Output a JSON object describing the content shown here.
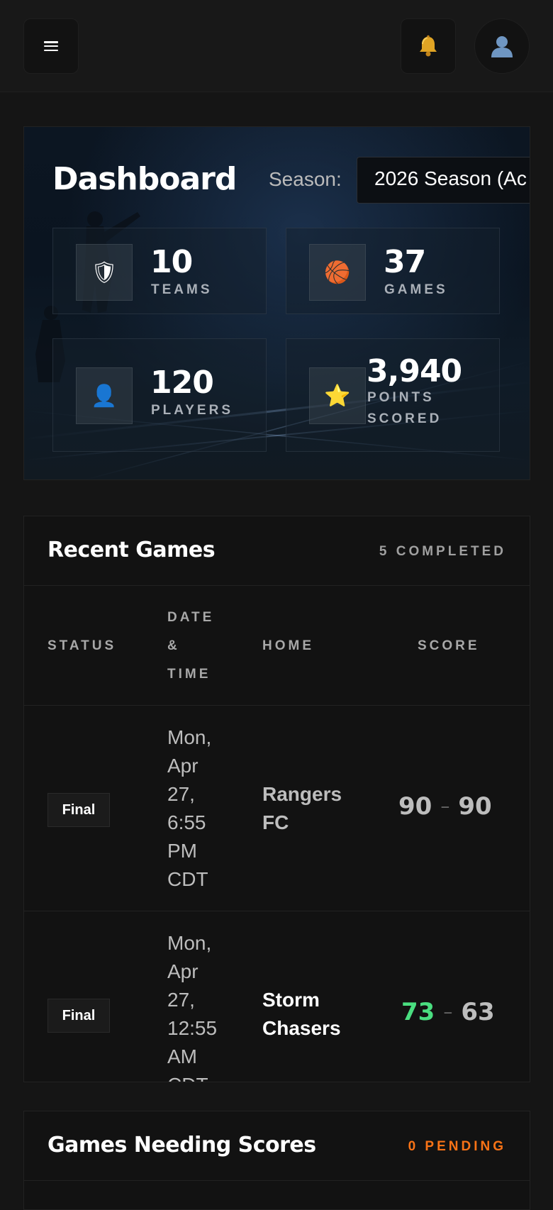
{
  "header": {
    "menu_icon": "hamburger-icon",
    "notification_icon": "bell-icon",
    "avatar_icon": "user-avatar-icon"
  },
  "hero": {
    "title": "Dashboard",
    "season_label": "Season:",
    "season_value": "2026 Season (Ac",
    "stats": [
      {
        "icon": "shield-icon",
        "glyph": "🛡",
        "value": "10",
        "label_lines": [
          "TEAMS"
        ]
      },
      {
        "icon": "basketball-icon",
        "glyph": "🏀",
        "value": "37",
        "label_lines": [
          "GAMES"
        ]
      },
      {
        "icon": "player-icon",
        "glyph": "👤",
        "value": "120",
        "label_lines": [
          "PLAYERS"
        ]
      },
      {
        "icon": "star-icon",
        "glyph": "⭐",
        "value": "3,940",
        "label_lines": [
          "POINTS",
          "SCORED"
        ]
      }
    ]
  },
  "recent_games": {
    "title": "Recent Games",
    "count": "5 COMPLETED",
    "columns": {
      "status": "STATUS",
      "datetime_lines": [
        "DATE",
        "&",
        "TIME"
      ],
      "home": "HOME",
      "score": "SCORE"
    },
    "rows": [
      {
        "status": "Final",
        "datetime_lines": [
          "Mon,",
          "Apr",
          "27,",
          "6:55",
          "PM",
          "CDT"
        ],
        "home_lines": [
          "Rangers",
          "FC"
        ],
        "home_score": "90",
        "separator": "–",
        "away_score": "90",
        "home_color": "#bdbdbd",
        "home_score_color": "#bdbdbd"
      },
      {
        "status": "Final",
        "datetime_lines": [
          "Mon,",
          "Apr",
          "27,",
          "12:55",
          "AM",
          "CDT"
        ],
        "home_lines": [
          "Storm",
          "Chasers"
        ],
        "home_score": "73",
        "separator": "–",
        "away_score": "63",
        "home_color": "#ffffff",
        "home_score_color": "#4ade80"
      }
    ]
  },
  "needing_scores": {
    "title": "Games Needing Scores",
    "count": "0 PENDING",
    "count_color": "#f97316"
  }
}
